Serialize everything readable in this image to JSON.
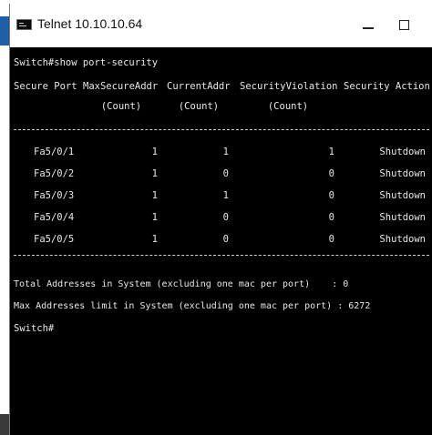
{
  "window": {
    "title": "Telnet 10.10.10.64",
    "icon": "console-icon"
  },
  "console": {
    "command_line": "Switch#show port-security",
    "headers": {
      "secure_port": "Secure Port",
      "max_secure_addr": "MaxSecureAddr",
      "max_secure_addr_sub": "(Count)",
      "current_addr": "CurrentAddr",
      "current_addr_sub": "(Count)",
      "security_violation": "SecurityViolation",
      "security_violation_sub": "(Count)",
      "security_action": "Security Action"
    },
    "rows": [
      {
        "port": "Fa5/0/1",
        "max": "1",
        "current": "1",
        "violation": "1",
        "action": "Shutdown"
      },
      {
        "port": "Fa5/0/2",
        "max": "1",
        "current": "0",
        "violation": "0",
        "action": "Shutdown"
      },
      {
        "port": "Fa5/0/3",
        "max": "1",
        "current": "1",
        "violation": "0",
        "action": "Shutdown"
      },
      {
        "port": "Fa5/0/4",
        "max": "1",
        "current": "0",
        "violation": "0",
        "action": "Shutdown"
      },
      {
        "port": "Fa5/0/5",
        "max": "1",
        "current": "0",
        "violation": "0",
        "action": "Shutdown"
      }
    ],
    "total_line": "Total Addresses in System (excluding one mac per port)    : 0",
    "max_line": "Max Addresses limit in System (excluding one mac per port) : 6272",
    "prompt": "Switch#"
  }
}
